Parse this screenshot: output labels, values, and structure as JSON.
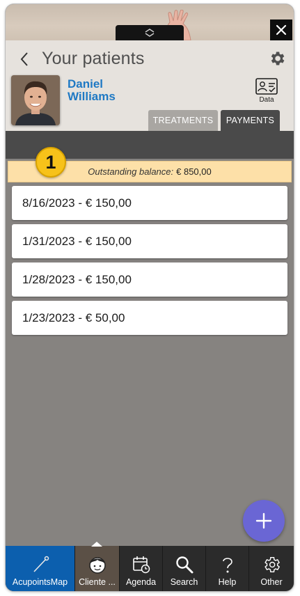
{
  "header": {
    "title": "Your patients",
    "back_icon": "chevron-left-icon",
    "settings_icon": "gear-icon"
  },
  "patient": {
    "first_name": "Daniel",
    "last_name": "Williams",
    "name_color": "#1f79c4"
  },
  "data_button": {
    "label": "Data",
    "icon": "id-card-icon"
  },
  "tabs": [
    {
      "label": "TREATMENTS",
      "active": false
    },
    {
      "label": "PAYMENTS",
      "active": true
    }
  ],
  "badge": {
    "text": "1",
    "color": "#f7c21a"
  },
  "balance": {
    "label": "Outstanding balance:",
    "amount": "€ 850,00",
    "background": "#fde0a8"
  },
  "payments": [
    {
      "text": "8/16/2023 - € 150,00"
    },
    {
      "text": "1/31/2023 - € 150,00"
    },
    {
      "text": "1/28/2023 - € 150,00"
    },
    {
      "text": "1/23/2023 - € 50,00"
    }
  ],
  "fab": {
    "icon": "plus-icon",
    "color": "#6a66d4"
  },
  "bottom_nav": [
    {
      "label": "AcupointsMap",
      "icon": "needle-icon",
      "active": false
    },
    {
      "label": "Cliente ...",
      "icon": "client-face-icon",
      "active": true
    },
    {
      "label": "Agenda",
      "icon": "calendar-icon",
      "active": false
    },
    {
      "label": "Search",
      "icon": "search-icon",
      "active": false
    },
    {
      "label": "Help",
      "icon": "help-icon",
      "active": false
    },
    {
      "label": "Other",
      "icon": "gear-icon",
      "active": false
    }
  ],
  "colors": {
    "accent_nav": "#0c5fae",
    "dark_bar": "#4a4a4a",
    "background": "#868380"
  }
}
